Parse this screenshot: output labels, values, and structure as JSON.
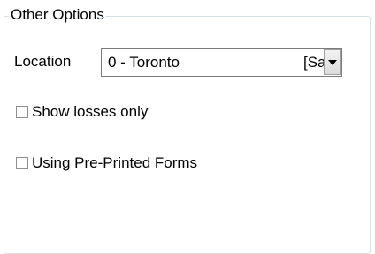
{
  "group": {
    "title": "Other Options"
  },
  "location": {
    "label": "Location",
    "selected_value": "0 - Toronto",
    "selected_suffix": "[Sa"
  },
  "options": {
    "show_losses": {
      "label": "Show losses only",
      "checked": false
    },
    "preprinted": {
      "label": "Using Pre-Printed Forms",
      "checked": false
    }
  }
}
